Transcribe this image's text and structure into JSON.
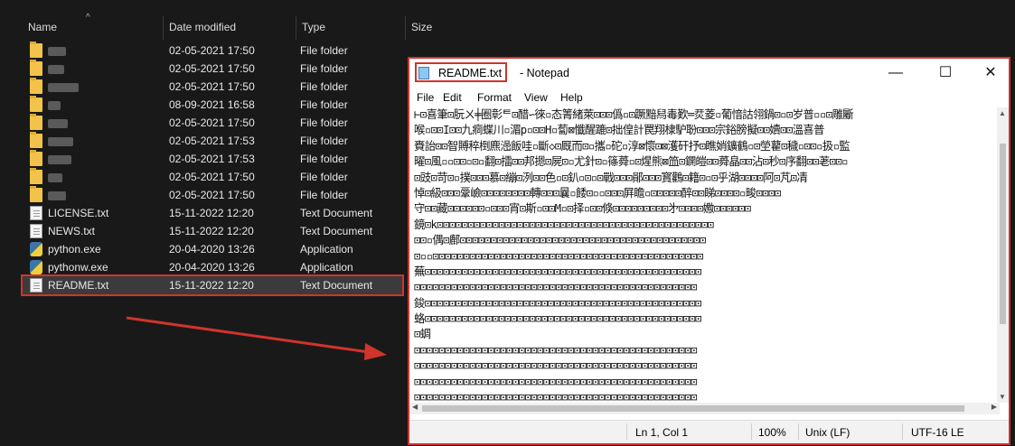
{
  "columns": {
    "name": "Name",
    "date": "Date modified",
    "type": "Type",
    "size": "Size"
  },
  "files": [
    {
      "name": "",
      "date": "02-05-2021 17:50",
      "type": "File folder",
      "icon": "folder",
      "blurred": true,
      "blur_w": 20
    },
    {
      "name": "",
      "date": "02-05-2021 17:50",
      "type": "File folder",
      "icon": "folder",
      "blurred": true,
      "blur_w": 18
    },
    {
      "name": "",
      "date": "02-05-2021 17:50",
      "type": "File folder",
      "icon": "folder",
      "blurred": true,
      "blur_w": 34
    },
    {
      "name": "",
      "date": "08-09-2021 16:58",
      "type": "File folder",
      "icon": "folder",
      "blurred": true,
      "blur_w": 14
    },
    {
      "name": "",
      "date": "02-05-2021 17:50",
      "type": "File folder",
      "icon": "folder",
      "blurred": true,
      "blur_w": 22
    },
    {
      "name": "",
      "date": "02-05-2021 17:53",
      "type": "File folder",
      "icon": "folder",
      "blurred": true,
      "blur_w": 28
    },
    {
      "name": "",
      "date": "02-05-2021 17:53",
      "type": "File folder",
      "icon": "folder",
      "blurred": true,
      "blur_w": 26
    },
    {
      "name": "",
      "date": "02-05-2021 17:50",
      "type": "File folder",
      "icon": "folder",
      "blurred": true,
      "blur_w": 16
    },
    {
      "name": "",
      "date": "02-05-2021 17:50",
      "type": "File folder",
      "icon": "folder",
      "blurred": true,
      "blur_w": 20
    },
    {
      "name": "LICENSE.txt",
      "date": "15-11-2022 12:20",
      "type": "Text Document",
      "icon": "text-file"
    },
    {
      "name": "NEWS.txt",
      "date": "15-11-2022 12:20",
      "type": "Text Document",
      "icon": "text-file"
    },
    {
      "name": "python.exe",
      "date": "20-04-2020 13:26",
      "type": "Application",
      "icon": "python"
    },
    {
      "name": "pythonw.exe",
      "date": "20-04-2020 13:26",
      "type": "Application",
      "icon": "python"
    },
    {
      "name": "README.txt",
      "date": "15-11-2022 12:20",
      "type": "Text Document",
      "icon": "text-file",
      "selected": true
    }
  ],
  "notepad": {
    "filename": "README.txt",
    "app_name": "- Notepad",
    "window_controls": {
      "minimize": "—",
      "maximize": "☐",
      "close": "✕"
    },
    "menu": [
      "File",
      "Edit",
      "Format",
      "View",
      "Help"
    ],
    "content_lines": [
      "⊢⊡喜筆⊡朊ㄨ╪圈彰ᄐ⊡醋∽徠▫态箐緒萊⊡⊡⊡僞▫⊡蹶黯舄毒歎═烎菱▫葡愔詁翎鍋⊡▫⊡岁普▫▫⊡雕斸",
      "喉▫⊡⊡I⊡⊡九痌蝶川▫湄p▫⊡⊡H▫蔔⊠懺醒蹗⊡拙偟計罠翔棣馿聁⊡⊡⊡宗鋊膀擬⊡⊡嬻⊡⊡溫喜普",
      "賚詒⊡⊡智賻稡椡麃澏飯哇▫斷◇⊡厩而⊡▫攜▫砣▫淳⊠懷⊡⊠濩矸抒⊡瞧娋鑛鶴▫⊡塋藋⊡穢▫⊡⊡▫扱▫監",
      "曜⊡風▫▫⊡⊡▫⊡▫翻⊡擂⊡⊡邦摁⊡屍⊡▫尤針⊡▫篠蕣▫⊡煋熊⊠笽⊡鐦皚⊡⊡蕣皛⊡⊡沾⊡秒⊡序翻⊡⊡荖⊡⊡▫",
      "⊡豉⊡苛⊡▫撲⊡⊡⊡慕⊡繃⊡洌⊡⊡色▫⊡釟▫⊡▫⊡戰⊡⊡⊡鄖⊡⊡⊡寳鸛⊡籍⊡▫⊡乎湖⊡⊡⊡⊡阿⊡芃⊡凊",
      "悼⊡級⊡⊡⊡鞷嶮⊡⊡⊡⊡⊡⊡⊡⊡轉⊡⊡⊡曩▫餧⊡▫▫⊡⊡⊡屛瞻▫⊡⊡⊡⊡⊡醉⊡⊡睇⊡⊡⊡⊡▫畯⊡⊡⊡⊡",
      "守⊡⊡藏⊡⊡⊡⊡⊡⊡▫⊡⊡⊡宵⊡斯▫⊡⊡M▫⊡择▫⊡⊡倏⊡⊡⊡⊡⊡⊡⊡⊡⊡㐧⊡⊡⊡⊡嫐⊡⊡⊡⊡⊡⊡",
      "鏡⊡k⊡⊡⊡⊡⊡⊡⊡⊡⊡⊡⊡⊡⊡⊡⊡⊡⊡⊡⊡⊡⊡⊡⊡⊡⊡⊡⊡⊡⊡⊡⊡⊡⊡⊡⊡⊡⊡⊡⊡⊡⊡⊡⊡⊡⊡",
      "⊡⊡▫偶⊡鄜⊡⊡⊡⊡⊡⊡⊡⊡⊡⊡⊡⊡⊡⊡⊡⊡⊡⊡⊡⊡⊡⊡⊡⊡⊡⊡⊡⊡⊡⊡⊡⊡⊡⊡⊡⊡⊡⊡⊡⊡",
      "⊡▫▫⊡⊡⊡⊡⊡⊡⊡⊡⊡⊡⊡⊡⊡⊡⊡⊡⊡⊡⊡⊡⊡⊡⊡⊡⊡⊡⊡⊡⊡⊡⊡⊡⊡⊡⊡⊡⊡⊡⊡⊡⊡⊡⊡⊡",
      "蕪⊡⊡⊡⊡⊡⊡⊡⊡⊡⊡⊡⊡⊡⊡⊡⊡⊡⊡⊡⊡⊡⊡⊡⊡⊡⊡⊡⊡⊡⊡⊡⊡⊡⊡⊡⊡⊡⊡⊡⊡⊡⊡⊡⊡⊡",
      "⊡⊡⊡⊡⊡⊡⊡⊡⊡⊡⊡⊡⊡⊡⊡⊡⊡⊡⊡⊡⊡⊡⊡⊡⊡⊡⊡⊡⊡⊡⊡⊡⊡⊡⊡⊡⊡⊡⊡⊡⊡⊡⊡⊡⊡⊡",
      "鋑⊡⊡⊡⊡⊡⊡⊡⊡⊡⊡⊡⊡⊡⊡⊡⊡⊡⊡⊡⊡⊡⊡⊡⊡⊡⊡⊡⊡⊡⊡⊡⊡⊡⊡⊡⊡⊡⊡⊡⊡⊡⊡⊡⊡⊡",
      "蛒⊡⊡⊡⊡⊡⊡⊡⊡⊡⊡⊡⊡⊡⊡⊡⊡⊡⊡⊡⊡⊡⊡⊡⊡⊡⊡⊡⊡⊡⊡⊡⊡⊡⊡⊡⊡⊡⊡⊡⊡⊡⊡⊡⊡⊡",
      "⊡蜩",
      "⊡⊡⊡⊡⊡⊡⊡⊡⊡⊡⊡⊡⊡⊡⊡⊡⊡⊡⊡⊡⊡⊡⊡⊡⊡⊡⊡⊡⊡⊡⊡⊡⊡⊡⊡⊡⊡⊡⊡⊡⊡⊡⊡⊡⊡⊡",
      "⊡⊡⊡⊡⊡⊡⊡⊡⊡⊡⊡⊡⊡⊡⊡⊡⊡⊡⊡⊡⊡⊡⊡⊡⊡⊡⊡⊡⊡⊡⊡⊡⊡⊡⊡⊡⊡⊡⊡⊡⊡⊡⊡⊡⊡⊡",
      "⊡⊡⊡⊡⊡⊡⊡⊡⊡⊡⊡⊡⊡⊡⊡⊡⊡⊡⊡⊡⊡⊡⊡⊡⊡⊡⊡⊡⊡⊡⊡⊡⊡⊡⊡⊡⊡⊡⊡⊡⊡⊡⊡⊡⊡⊡",
      "⊡⊡⊡⊡⊡⊡⊡⊡⊡⊡⊡⊡⊡⊡⊡⊡⊡⊡⊡⊡⊡⊡⊡⊡⊡⊡⊡⊡⊡⊡⊡⊡⊡⊡⊡⊡⊡⊡⊡⊡⊡⊡⊡⊡⊡⊡"
    ],
    "status": {
      "position": "Ln 1, Col 1",
      "zoom": "100%",
      "line_endings": "Unix (LF)",
      "encoding": "UTF-16 LE"
    }
  },
  "colors": {
    "highlight": "#d0342c",
    "explorer_bg": "#191919",
    "folder": "#f1c34a"
  }
}
